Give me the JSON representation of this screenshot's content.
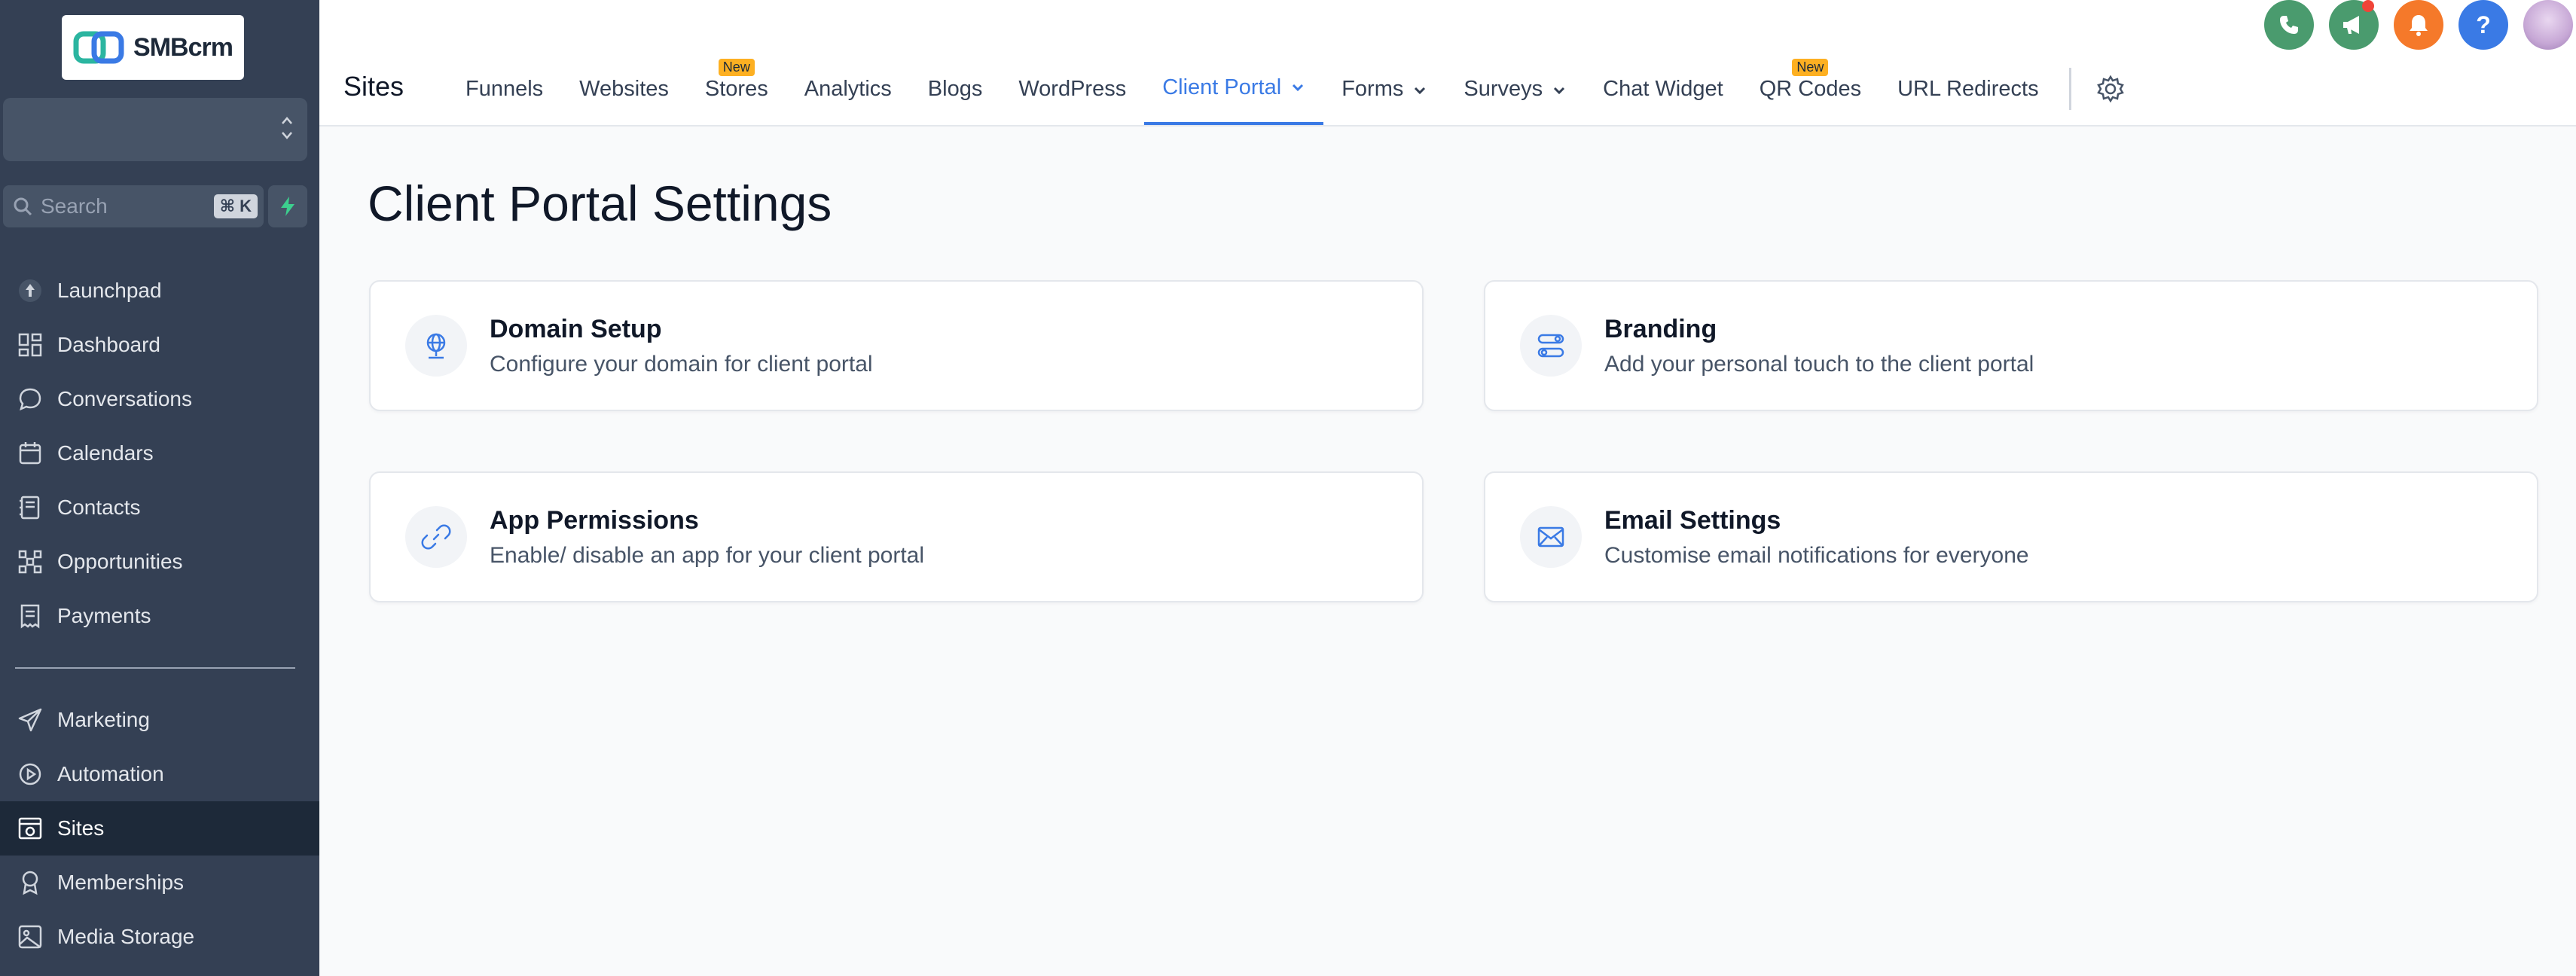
{
  "brand": {
    "name": "SMBcrm"
  },
  "sidebar": {
    "search_placeholder": "Search",
    "search_shortcut": "⌘ K",
    "items": [
      {
        "label": "Launchpad",
        "icon": "launchpad-icon"
      },
      {
        "label": "Dashboard",
        "icon": "dashboard-icon"
      },
      {
        "label": "Conversations",
        "icon": "chat-icon"
      },
      {
        "label": "Calendars",
        "icon": "calendar-icon"
      },
      {
        "label": "Contacts",
        "icon": "contacts-icon"
      },
      {
        "label": "Opportunities",
        "icon": "opportunities-icon"
      },
      {
        "label": "Payments",
        "icon": "payments-icon"
      },
      {
        "label": "Marketing",
        "icon": "send-icon"
      },
      {
        "label": "Automation",
        "icon": "automation-icon"
      },
      {
        "label": "Sites",
        "icon": "sites-icon",
        "active": true
      },
      {
        "label": "Memberships",
        "icon": "award-icon"
      },
      {
        "label": "Media Storage",
        "icon": "image-icon"
      }
    ]
  },
  "header": {
    "section_title": "Sites",
    "tabs": [
      {
        "label": "Funnels"
      },
      {
        "label": "Websites"
      },
      {
        "label": "Stores",
        "badge": "New"
      },
      {
        "label": "Analytics"
      },
      {
        "label": "Blogs"
      },
      {
        "label": "WordPress"
      },
      {
        "label": "Client Portal",
        "active": true
      },
      {
        "label": "Forms"
      },
      {
        "label": "Surveys"
      },
      {
        "label": "Chat Widget"
      },
      {
        "label": "QR Codes",
        "badge": "New"
      },
      {
        "label": "URL Redirects"
      }
    ],
    "top_icons": [
      "phone-icon",
      "megaphone-icon",
      "bell-icon",
      "help-icon",
      "avatar"
    ],
    "colors": {
      "phone": "#4a9b6e",
      "megaphone": "#4a9b6e",
      "bell": "#f5792a",
      "help": "#3a7ae5"
    }
  },
  "main": {
    "title": "Client Portal Settings",
    "cards": [
      {
        "title": "Domain Setup",
        "description": "Configure your domain for client portal",
        "icon": "globe-icon"
      },
      {
        "title": "Branding",
        "description": "Add your personal touch to the client portal",
        "icon": "toggles-icon"
      },
      {
        "title": "App Permissions",
        "description": "Enable/ disable an app for your client portal",
        "icon": "link-icon"
      },
      {
        "title": "Email Settings",
        "description": "Customise email notifications for everyone",
        "icon": "mail-icon"
      }
    ]
  },
  "accent": "#3a7ae5"
}
